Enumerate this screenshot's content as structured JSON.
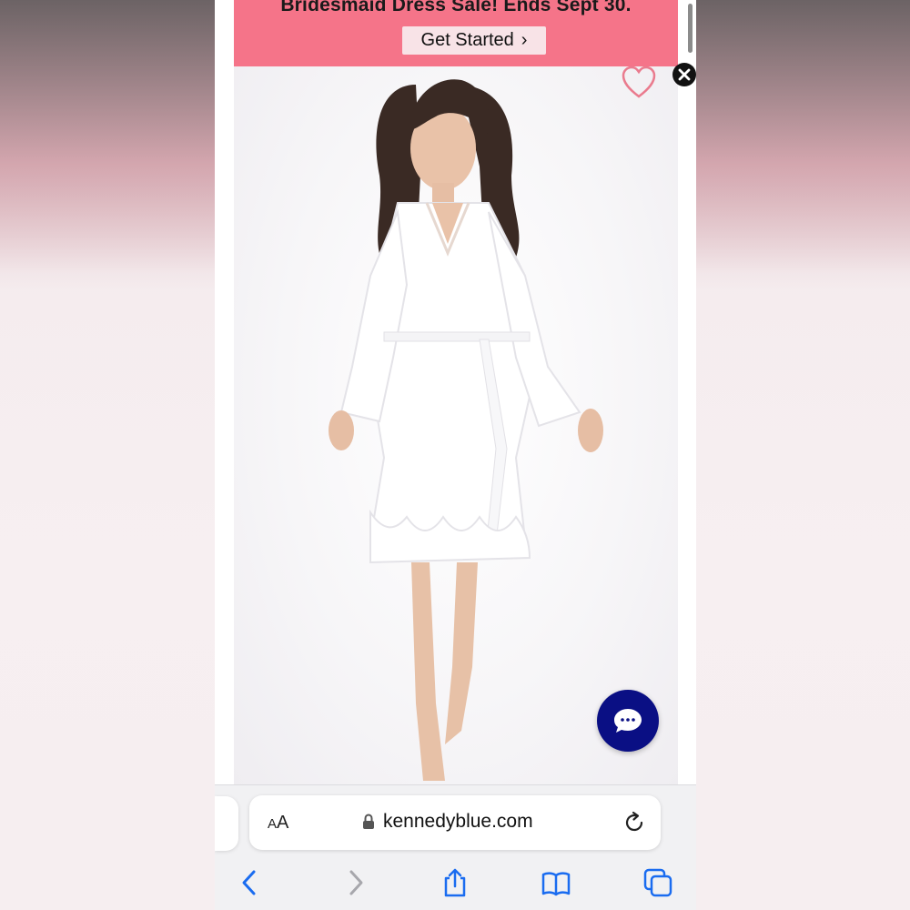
{
  "promo": {
    "headline": "Bridesmaid Dress Sale! Ends Sept 30.",
    "cta_label": "Get Started",
    "cta_chevron": "›"
  },
  "colors": {
    "promo_bg": "#f57489",
    "cta_bg": "#f8e3e7",
    "chat_bg": "#0a0f84",
    "heart": "#ea7b8e"
  },
  "product": {
    "image_icon": "product-photo-white-ruffle-robe",
    "heart_icon": "heart-icon",
    "close_icon": "close-icon",
    "chat_icon": "chat-bubble-icon"
  },
  "browser": {
    "aa_label_small": "A",
    "aa_label_large": "A",
    "url": "kennedyblue.com",
    "lock_icon": "lock-icon",
    "reload_icon": "reload-icon",
    "toolbar": [
      "back-icon",
      "forward-icon",
      "share-icon",
      "bookmarks-icon",
      "tabs-icon"
    ]
  }
}
